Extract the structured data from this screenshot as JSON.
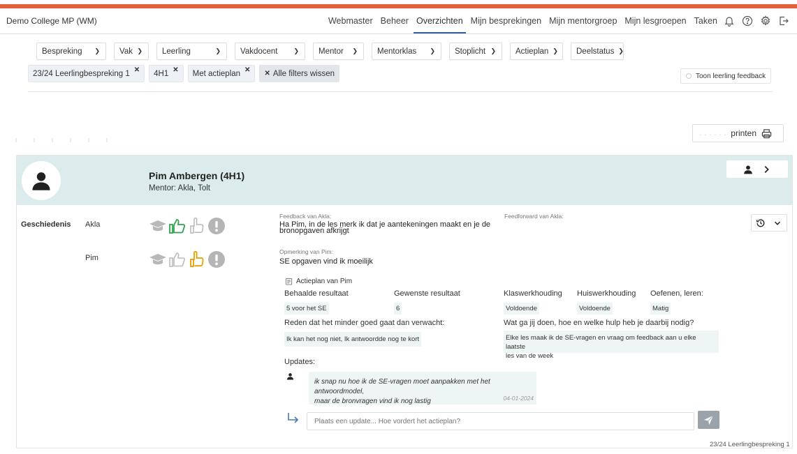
{
  "brand": "Demo College MP (WM)",
  "nav": {
    "items": [
      {
        "label": "Webmaster"
      },
      {
        "label": "Beheer"
      },
      {
        "label": "Overzichten"
      },
      {
        "label": "Mijn besprekingen"
      },
      {
        "label": "Mijn mentorgroep"
      },
      {
        "label": "Mijn lesgroepen"
      },
      {
        "label": "Taken"
      }
    ],
    "active": "Overzichten",
    "icons": [
      "bell-icon",
      "help-icon",
      "settings-icon",
      "logout-icon"
    ]
  },
  "filters": [
    {
      "label": "Bespreking"
    },
    {
      "label": "Vak"
    },
    {
      "label": "Leerling"
    },
    {
      "label": "Vakdocent"
    },
    {
      "label": "Mentor"
    },
    {
      "label": "Mentorklas"
    },
    {
      "label": "Stoplicht"
    },
    {
      "label": "Actieplan"
    },
    {
      "label": "Deelstatus"
    }
  ],
  "chips": [
    {
      "label": "23/24 Leerlingbespreking 1"
    },
    {
      "label": "4H1"
    },
    {
      "label": "Met actieplan"
    }
  ],
  "clear_filters": "Alle filters wissen",
  "feedback_toggle": "Toon leerling feedback",
  "print": {
    "label": "printen",
    "faded": ". . . .  . ."
  },
  "student": {
    "name": "Pim Ambergen (4H1)",
    "mentor": "Mentor: Akla, Tolt"
  },
  "subject": "Geschiedenis",
  "rows": {
    "teacher": {
      "name": "Akla",
      "rating": "thumbs-up",
      "rating_color": "#2ea44f"
    },
    "student": {
      "name": "Pim",
      "rating": "pointing-hand",
      "rating_color": "#e5a100"
    }
  },
  "feedback": {
    "label": "Feedback van Akla:",
    "text_line1": "Ha Pim, in de les merk ik dat je aantekeningen maakt en je de",
    "text_line2": "bronopgaven afkrijgt",
    "feedforward_label": "Feedforward van Akla:"
  },
  "remark": {
    "label": "Opmerking van Pim:",
    "text": "SE opgaven vind ik moeilijk"
  },
  "action_plan": {
    "title": "Actieplan van Pim",
    "headers": {
      "achieved": "Behaalde resultaat",
      "desired": "Gewenste resultaat",
      "class_attitude": "Klaswerkhouding",
      "homework_attitude": "Huiswerkhouding",
      "practice": "Oefenen, leren:"
    },
    "values": {
      "achieved": "5 voor het SE",
      "desired": "6",
      "class_attitude": "Voldoende",
      "homework_attitude": "Voldoende",
      "practice": "Matig"
    },
    "reason_label": "Reden dat het minder goed gaat dan verwacht:",
    "reason_text": "Ik kan het nog niet, Ik antwoordde nog te kort",
    "plan_label": "Wat ga jij doen, hoe en welke hulp heb je daarbij nodig?",
    "plan_line1": "Elke les maak ik de SE-vragen en vraag om feedback aan u elke laatste",
    "plan_line2": "les van de week"
  },
  "updates": {
    "label": "Updates:",
    "message_line1": "ik snap nu hoe ik de SE-vragen moet aanpakken met het antwoordmodel,",
    "message_line2": "maar de bronvragen vind ik nog lastig",
    "date": "04-01-2024",
    "input_placeholder": "Plaats een update... Hoe vordert het actieplan?"
  },
  "footer_tag": "23/24 Leerlingbespreking 1",
  "colors": {
    "accent_stripe": "#e2603a",
    "card_header": "#dcecec",
    "active_tab": "#2f5f9c"
  }
}
